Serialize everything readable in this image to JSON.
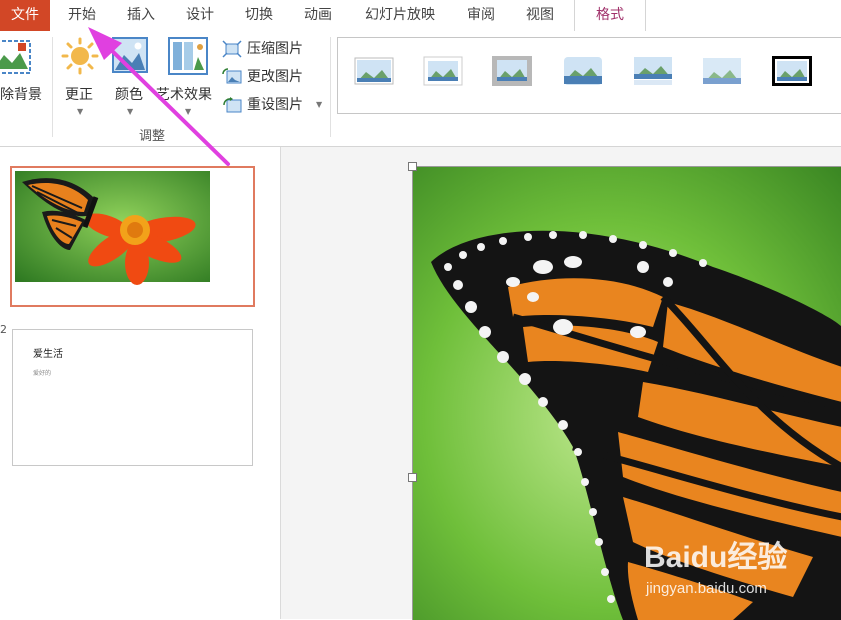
{
  "tabs": {
    "file": "文件",
    "home": "开始",
    "insert": "插入",
    "design": "设计",
    "transitions": "切换",
    "animations": "动画",
    "slideshow": "幻灯片放映",
    "review": "审阅",
    "view": "视图",
    "format": "格式"
  },
  "ribbon": {
    "remove_background": "除背景",
    "corrections": "更正",
    "color": "颜色",
    "artistic_effects": "艺术效果",
    "compress_pictures": "压缩图片",
    "change_picture": "更改图片",
    "reset_picture": "重设图片",
    "group_adjust": "调整"
  },
  "slides": {
    "slide2_number": "2",
    "slide2_title": "爱生活",
    "slide2_subtitle": "爱好的"
  },
  "watermark": {
    "brand": "Baidu经验",
    "url": "jingyan.baidu.com"
  },
  "colors": {
    "file_tab": "#d24726",
    "format_tab_text": "#a0306a",
    "selected_slide_border": "#e07a5f",
    "annotation_arrow": "#e040e0"
  }
}
